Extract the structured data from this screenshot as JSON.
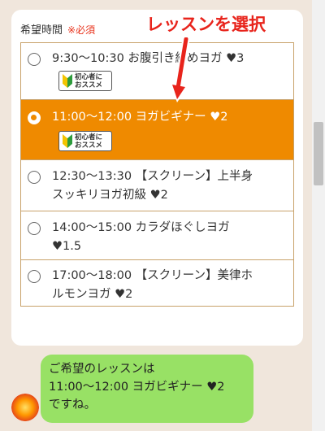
{
  "form": {
    "label": "希望時間",
    "required": "※必須"
  },
  "callout": "レッスンを選択",
  "options": [
    {
      "line1": "9:30〜10:30 お腹引き締めヨガ ♥3",
      "line2": "",
      "badge": "初心者に\nおススメ",
      "selected": false
    },
    {
      "line1": "11:00〜12:00 ヨガビギナー ♥2",
      "line2": "",
      "badge": "初心者に\nおススメ",
      "selected": true
    },
    {
      "line1": "12:30〜13:30 【スクリーン】上半身",
      "line2": "スッキリヨガ初級 ♥2",
      "badge": "",
      "selected": false
    },
    {
      "line1": "14:00〜15:00 カラダほぐしヨガ",
      "line2": "♥1.5",
      "badge": "",
      "selected": false
    },
    {
      "line1": "17:00〜18:00 【スクリーン】美律ホ",
      "line2": "ルモンヨガ ♥2",
      "badge": "",
      "selected": false
    }
  ],
  "chat": {
    "line1": "ご希望のレッスンは",
    "line2": "11:00〜12:00 ヨガビギナー ♥2",
    "line3": "ですね。"
  },
  "colors": {
    "selected_bg": "#ef8a00",
    "bubble": "#98e165",
    "required": "#e8331c",
    "callout": "#e8241c"
  }
}
